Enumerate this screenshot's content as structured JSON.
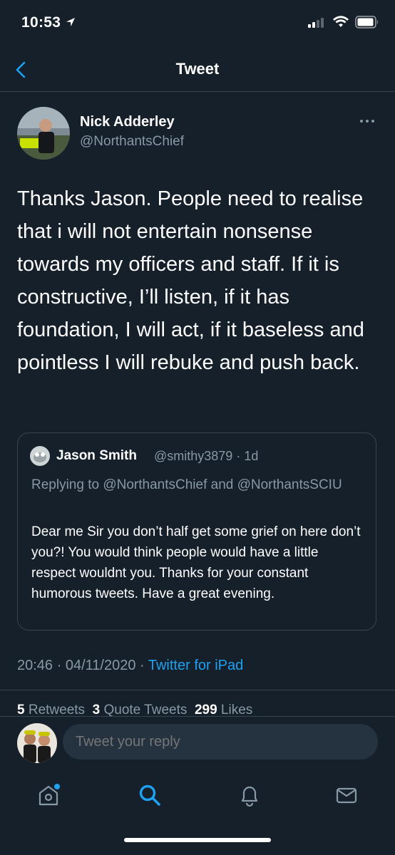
{
  "status_bar": {
    "time": "10:53"
  },
  "nav": {
    "title": "Tweet"
  },
  "tweet": {
    "author_name": "Nick Adderley",
    "author_handle": "@NorthantsChief",
    "text": "Thanks Jason. People need to realise that i will not entertain nonsense towards my officers and staff. If it is constructive, I’ll listen, if it has foundation, I will act, if it baseless and pointless I will rebuke and push back.",
    "quote": {
      "name": "Jason Smith",
      "handle_time": "@smithy3879 · 1d",
      "replying_to": "Replying to @NorthantsChief and @NorthantsSCIU",
      "text": "Dear me Sir you don’t half get some grief on here don’t you?! You would think people would have a little respect wouldnt you. Thanks for your constant humorous tweets. Have a great evening."
    },
    "timestamp": "20:46 · 04/11/2020 · ",
    "source": "Twitter for iPad",
    "stats": {
      "retweets_count": "5",
      "retweets_label": "Retweets",
      "quotes_count": "3",
      "quotes_label": "Quote Tweets",
      "likes_count": "299",
      "likes_label": "Likes"
    }
  },
  "reply": {
    "placeholder": "Tweet your reply"
  },
  "colors": {
    "background": "#15202b",
    "accent": "#1da1f2",
    "muted": "#8899a6",
    "border": "#38444d"
  },
  "icons": [
    "location-arrow-icon",
    "signal-icon",
    "wifi-icon",
    "battery-icon",
    "back-chevron-icon",
    "more-icon",
    "home-icon",
    "search-icon",
    "notifications-icon",
    "messages-icon"
  ]
}
